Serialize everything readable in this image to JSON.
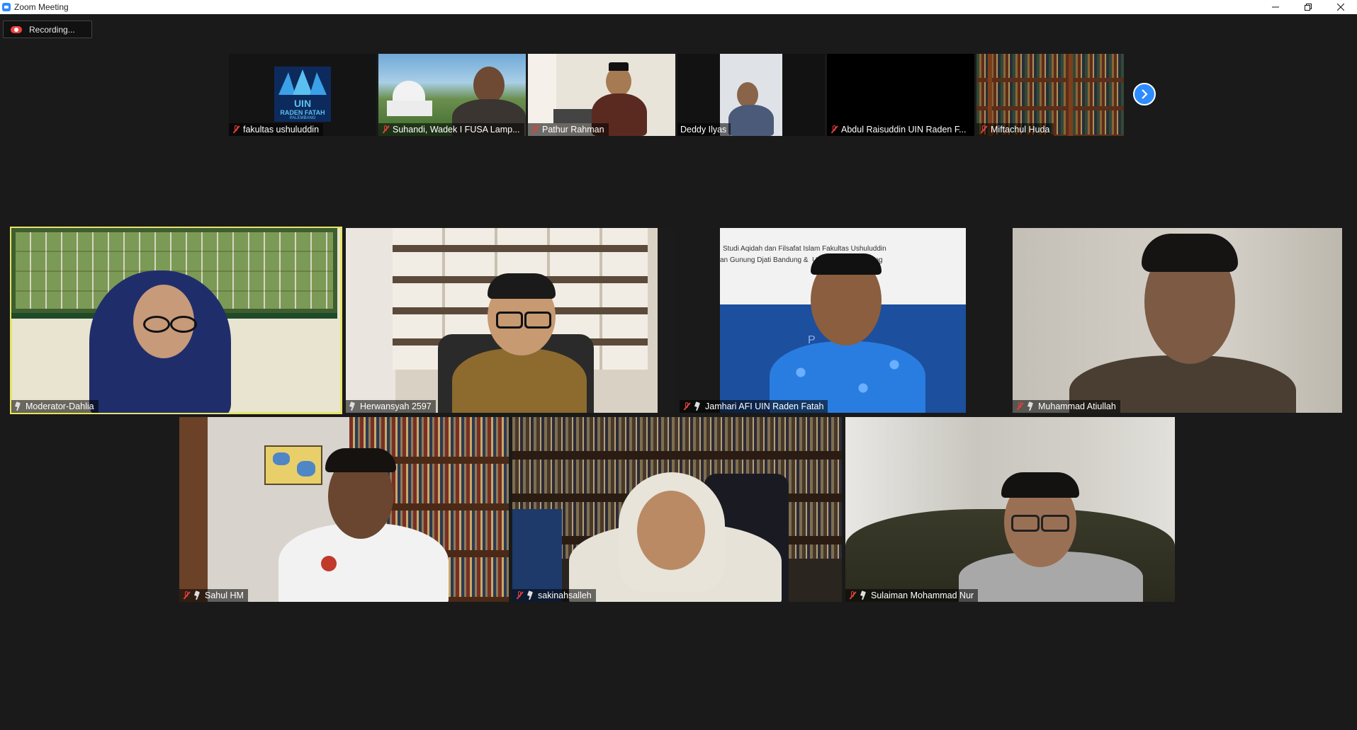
{
  "window": {
    "title": "Zoom Meeting"
  },
  "recording": {
    "label": "Recording..."
  },
  "thumbnails": [
    {
      "name": "fakultas ushuluddin",
      "muted": true,
      "logo_text": "UIN",
      "logo_sub": "RADEN FATAH",
      "logo_city": "PALEMBANG"
    },
    {
      "name": "Suhandi, Wadek I FUSA Lamp...",
      "muted": true
    },
    {
      "name": "Pathur Rahman",
      "muted": true
    },
    {
      "name": "Deddy Ilyas",
      "muted": false
    },
    {
      "name": "Abdul Raisuddin UIN Raden F...",
      "muted": true
    },
    {
      "name": "Miftachul Huda",
      "muted": true
    }
  ],
  "tiles": [
    {
      "name": "Moderator-Dahlia",
      "muted": false,
      "pinned": true,
      "active": true
    },
    {
      "name": "Herwansyah 2597",
      "muted": false,
      "pinned": true
    },
    {
      "name": "Jamhari AFI UIN Raden Fatah",
      "muted": true,
      "pinned": true,
      "banner_line1": "Studi Aqidah dan Filsafat Islam Fakultas Ushuluddin",
      "banner_line2": "an Gunung Djati Bandung &  UI           h Palembang",
      "banner_letter": "P"
    },
    {
      "name": "Muhammad Atiullah",
      "muted": true,
      "pinned": true
    },
    {
      "name": "Sahul HM",
      "muted": true,
      "pinned": true
    },
    {
      "name": "sakinahsalleh",
      "muted": true,
      "pinned": true
    },
    {
      "name": "Sulaiman Mohammad Nur",
      "muted": true,
      "pinned": true
    }
  ],
  "icons": [
    "app-icon",
    "minimize-icon",
    "restore-icon",
    "close-icon",
    "record-icon",
    "mic-off-icon",
    "pin-icon",
    "chevron-right-icon"
  ],
  "colors": {
    "accent": "#2d8cff",
    "active_border": "#e6e56a",
    "muted_red": "#e0403a",
    "background": "#1a1a1a"
  }
}
